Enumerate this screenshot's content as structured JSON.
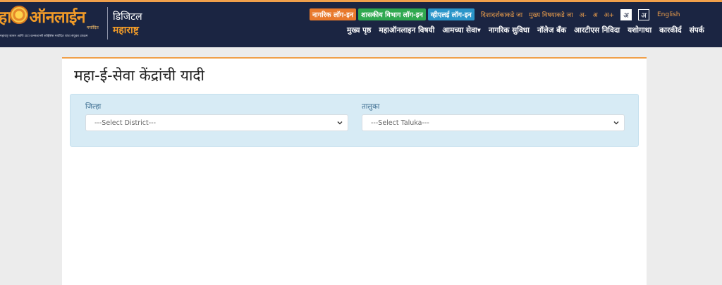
{
  "header": {
    "logo_text_left": "हा",
    "logo_text_right": "ऑनलाईन",
    "logo_sub": "मर्यादित",
    "logo_tagline": "महाराष्ट्र शासन आणि टाटा कन्सल्टन्सी सर्व्हिसेस मर्यादित यांचा संयुक्त उपक्रम",
    "digital": "डिजिटल",
    "maharashtra": "महाराष्ट्र",
    "top_buttons": [
      "नागरिक लॉग-इन",
      "शासकीय विभाग लॉग-इन",
      "व्हीएलई लॉग-इन"
    ],
    "skip_nav": "दिशादर्शकाकडे जा",
    "skip_main": "मुख्य विषयाकडे जा",
    "font_sizes": [
      "अ-",
      "अ",
      "अ+"
    ],
    "contrast_light": "अ",
    "contrast_dark": "अ",
    "language": "English",
    "nav": [
      "मुख्य पृष्ठ",
      "महाऑनलाइन विषयी",
      "आमच्या सेवा▾",
      "नागरिक सुविधा",
      "नॉलेज बँक",
      "आरटीएस निविदा",
      "यशोगाथा",
      "कारकीर्द",
      "संपर्क"
    ]
  },
  "page": {
    "title": "महा-ई-सेवा केंद्रांची यादी",
    "district": {
      "label": "जिल्हा",
      "selected": "---Select District---"
    },
    "taluka": {
      "label": "तालुका",
      "selected": "---Select Taluka---"
    }
  }
}
